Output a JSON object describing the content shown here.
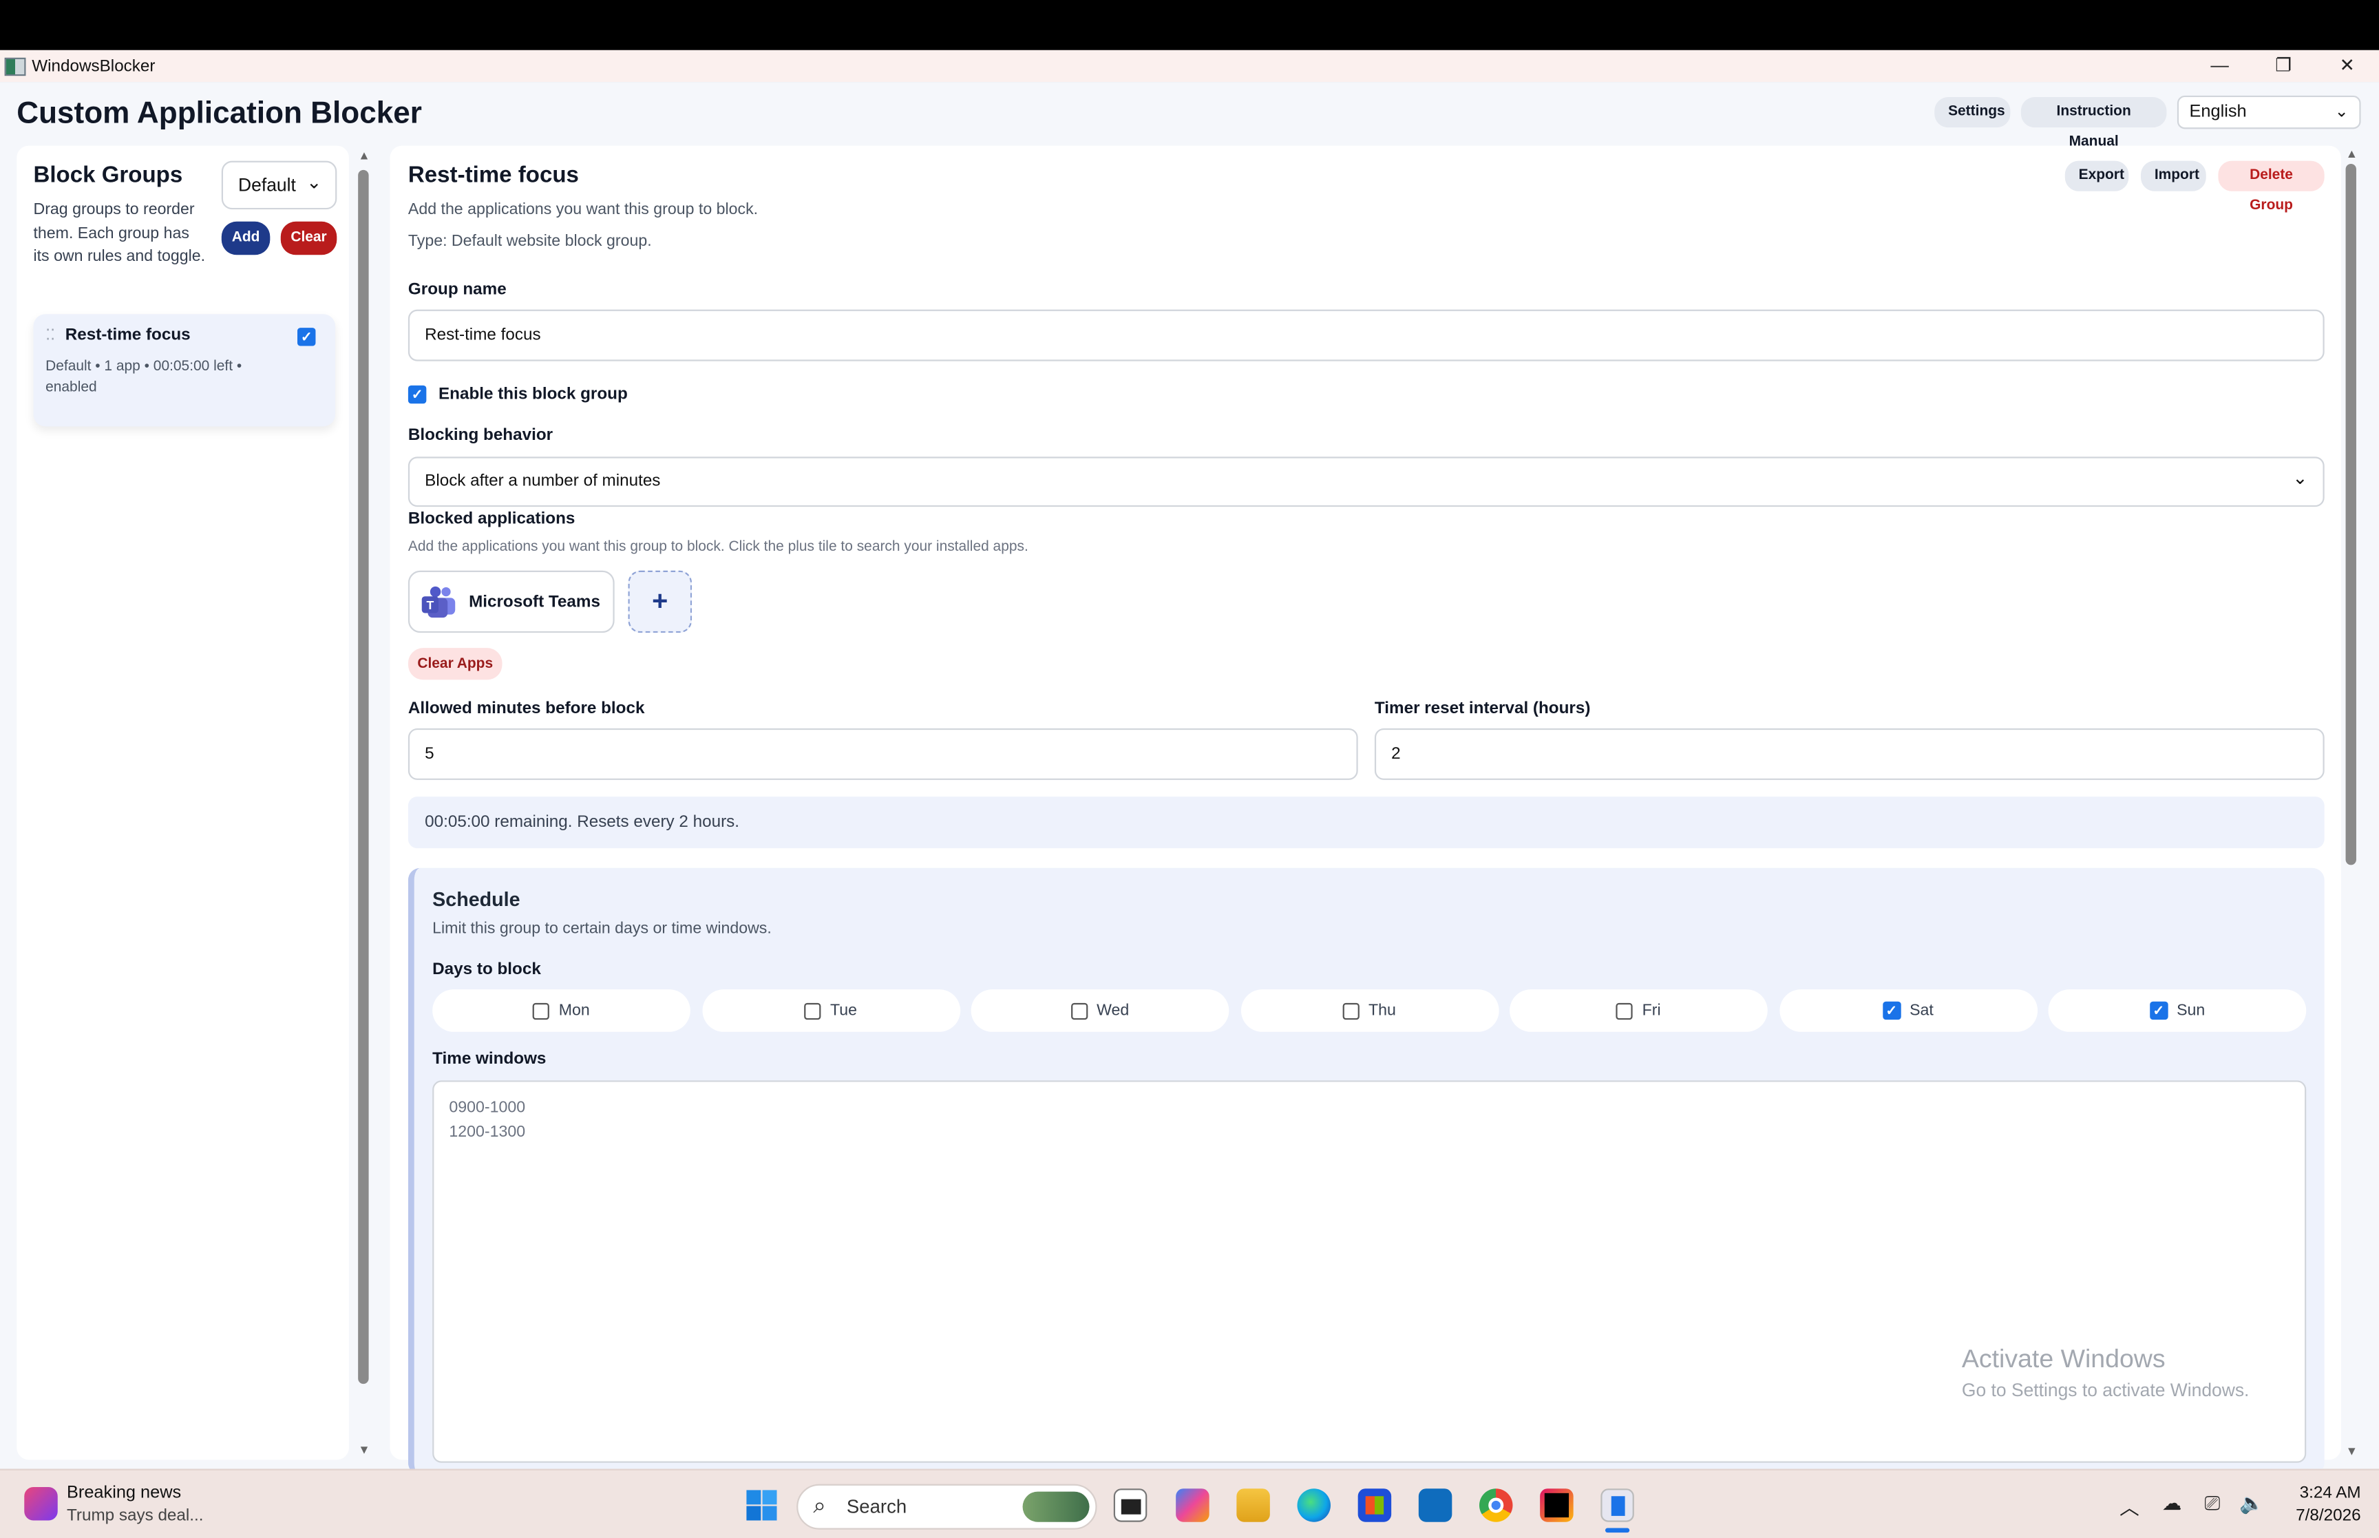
{
  "window": {
    "app_name": "WindowsBlocker",
    "minimize_glyph": "—",
    "restore_glyph": "❐",
    "close_glyph": "✕"
  },
  "header": {
    "title": "Custom Application Blocker",
    "settings_label": "Settings",
    "manual_label": "Instruction Manual",
    "language_value": "English"
  },
  "sidebar": {
    "title": "Block Groups",
    "description": "Drag groups to reorder them. Each group has its own rules and toggle.",
    "filter_value": "Default",
    "add_label": "Add",
    "clear_label": "Clear",
    "groups": [
      {
        "name": "Rest-time focus",
        "meta": "Default • 1 app • 00:05:00 left • enabled",
        "checked": true
      }
    ]
  },
  "editor": {
    "title": "Rest-time focus",
    "subtitle": "Add the applications you want this group to block.",
    "type_text": "Type: Default website block group.",
    "export_label": "Export",
    "import_label": "Import",
    "delete_label": "Delete Group",
    "group_name_label": "Group name",
    "group_name_value": "Rest-time focus",
    "enable_label": "Enable this block group",
    "behavior_label": "Blocking behavior",
    "behavior_value": "Block after a number of minutes",
    "blocked_apps_label": "Blocked applications",
    "blocked_apps_help": "Add the applications you want this group to block. Click the plus tile to search your installed apps.",
    "apps": [
      {
        "name": "Microsoft Teams",
        "icon": "teams-icon"
      }
    ],
    "add_app_glyph": "+",
    "clear_apps_label": "Clear Apps",
    "allowed_minutes_label": "Allowed minutes before block",
    "allowed_minutes_value": "5",
    "reset_interval_label": "Timer reset interval (hours)",
    "reset_interval_value": "2",
    "status_text": "00:05:00 remaining. Resets every 2 hours.",
    "schedule": {
      "title": "Schedule",
      "description": "Limit this group to certain days or time windows.",
      "days_label": "Days to block",
      "days": [
        {
          "label": "Mon",
          "checked": false
        },
        {
          "label": "Tue",
          "checked": false
        },
        {
          "label": "Wed",
          "checked": false
        },
        {
          "label": "Thu",
          "checked": false
        },
        {
          "label": "Fri",
          "checked": false
        },
        {
          "label": "Sat",
          "checked": true
        },
        {
          "label": "Sun",
          "checked": true
        }
      ],
      "time_windows_label": "Time windows",
      "time_windows_line1": "0900-1000",
      "time_windows_line2": "1200-1300"
    }
  },
  "watermark": {
    "line1": "Activate Windows",
    "line2": "Go to Settings to activate Windows."
  },
  "taskbar": {
    "news_title": "Breaking news",
    "news_text": "Trump says deal...",
    "search_placeholder": "Search",
    "time": "3:24 AM",
    "date": "7/8/2026",
    "pinned": [
      "start-icon",
      "task-view-icon",
      "m365-copilot-icon",
      "file-explorer-icon",
      "edge-icon",
      "store-icon",
      "outlook-icon",
      "chrome-icon",
      "rider-icon",
      "windowsblocker-icon"
    ]
  },
  "colors": {
    "accent": "#1a73e8",
    "primary_dark": "#1e3a8a",
    "danger": "#b91c1c",
    "panel_tint": "#eef2fc"
  }
}
